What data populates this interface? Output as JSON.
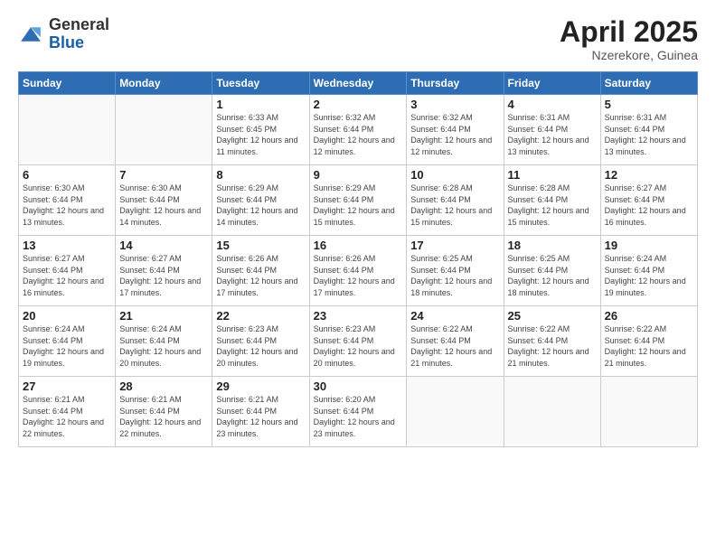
{
  "logo": {
    "general": "General",
    "blue": "Blue"
  },
  "title": "April 2025",
  "subtitle": "Nzerekore, Guinea",
  "days_header": [
    "Sunday",
    "Monday",
    "Tuesday",
    "Wednesday",
    "Thursday",
    "Friday",
    "Saturday"
  ],
  "weeks": [
    [
      {
        "day": "",
        "info": ""
      },
      {
        "day": "",
        "info": ""
      },
      {
        "day": "1",
        "info": "Sunrise: 6:33 AM\nSunset: 6:45 PM\nDaylight: 12 hours and 11 minutes."
      },
      {
        "day": "2",
        "info": "Sunrise: 6:32 AM\nSunset: 6:44 PM\nDaylight: 12 hours and 12 minutes."
      },
      {
        "day": "3",
        "info": "Sunrise: 6:32 AM\nSunset: 6:44 PM\nDaylight: 12 hours and 12 minutes."
      },
      {
        "day": "4",
        "info": "Sunrise: 6:31 AM\nSunset: 6:44 PM\nDaylight: 12 hours and 13 minutes."
      },
      {
        "day": "5",
        "info": "Sunrise: 6:31 AM\nSunset: 6:44 PM\nDaylight: 12 hours and 13 minutes."
      }
    ],
    [
      {
        "day": "6",
        "info": "Sunrise: 6:30 AM\nSunset: 6:44 PM\nDaylight: 12 hours and 13 minutes."
      },
      {
        "day": "7",
        "info": "Sunrise: 6:30 AM\nSunset: 6:44 PM\nDaylight: 12 hours and 14 minutes."
      },
      {
        "day": "8",
        "info": "Sunrise: 6:29 AM\nSunset: 6:44 PM\nDaylight: 12 hours and 14 minutes."
      },
      {
        "day": "9",
        "info": "Sunrise: 6:29 AM\nSunset: 6:44 PM\nDaylight: 12 hours and 15 minutes."
      },
      {
        "day": "10",
        "info": "Sunrise: 6:28 AM\nSunset: 6:44 PM\nDaylight: 12 hours and 15 minutes."
      },
      {
        "day": "11",
        "info": "Sunrise: 6:28 AM\nSunset: 6:44 PM\nDaylight: 12 hours and 15 minutes."
      },
      {
        "day": "12",
        "info": "Sunrise: 6:27 AM\nSunset: 6:44 PM\nDaylight: 12 hours and 16 minutes."
      }
    ],
    [
      {
        "day": "13",
        "info": "Sunrise: 6:27 AM\nSunset: 6:44 PM\nDaylight: 12 hours and 16 minutes."
      },
      {
        "day": "14",
        "info": "Sunrise: 6:27 AM\nSunset: 6:44 PM\nDaylight: 12 hours and 17 minutes."
      },
      {
        "day": "15",
        "info": "Sunrise: 6:26 AM\nSunset: 6:44 PM\nDaylight: 12 hours and 17 minutes."
      },
      {
        "day": "16",
        "info": "Sunrise: 6:26 AM\nSunset: 6:44 PM\nDaylight: 12 hours and 17 minutes."
      },
      {
        "day": "17",
        "info": "Sunrise: 6:25 AM\nSunset: 6:44 PM\nDaylight: 12 hours and 18 minutes."
      },
      {
        "day": "18",
        "info": "Sunrise: 6:25 AM\nSunset: 6:44 PM\nDaylight: 12 hours and 18 minutes."
      },
      {
        "day": "19",
        "info": "Sunrise: 6:24 AM\nSunset: 6:44 PM\nDaylight: 12 hours and 19 minutes."
      }
    ],
    [
      {
        "day": "20",
        "info": "Sunrise: 6:24 AM\nSunset: 6:44 PM\nDaylight: 12 hours and 19 minutes."
      },
      {
        "day": "21",
        "info": "Sunrise: 6:24 AM\nSunset: 6:44 PM\nDaylight: 12 hours and 20 minutes."
      },
      {
        "day": "22",
        "info": "Sunrise: 6:23 AM\nSunset: 6:44 PM\nDaylight: 12 hours and 20 minutes."
      },
      {
        "day": "23",
        "info": "Sunrise: 6:23 AM\nSunset: 6:44 PM\nDaylight: 12 hours and 20 minutes."
      },
      {
        "day": "24",
        "info": "Sunrise: 6:22 AM\nSunset: 6:44 PM\nDaylight: 12 hours and 21 minutes."
      },
      {
        "day": "25",
        "info": "Sunrise: 6:22 AM\nSunset: 6:44 PM\nDaylight: 12 hours and 21 minutes."
      },
      {
        "day": "26",
        "info": "Sunrise: 6:22 AM\nSunset: 6:44 PM\nDaylight: 12 hours and 21 minutes."
      }
    ],
    [
      {
        "day": "27",
        "info": "Sunrise: 6:21 AM\nSunset: 6:44 PM\nDaylight: 12 hours and 22 minutes."
      },
      {
        "day": "28",
        "info": "Sunrise: 6:21 AM\nSunset: 6:44 PM\nDaylight: 12 hours and 22 minutes."
      },
      {
        "day": "29",
        "info": "Sunrise: 6:21 AM\nSunset: 6:44 PM\nDaylight: 12 hours and 23 minutes."
      },
      {
        "day": "30",
        "info": "Sunrise: 6:20 AM\nSunset: 6:44 PM\nDaylight: 12 hours and 23 minutes."
      },
      {
        "day": "",
        "info": ""
      },
      {
        "day": "",
        "info": ""
      },
      {
        "day": "",
        "info": ""
      }
    ]
  ]
}
